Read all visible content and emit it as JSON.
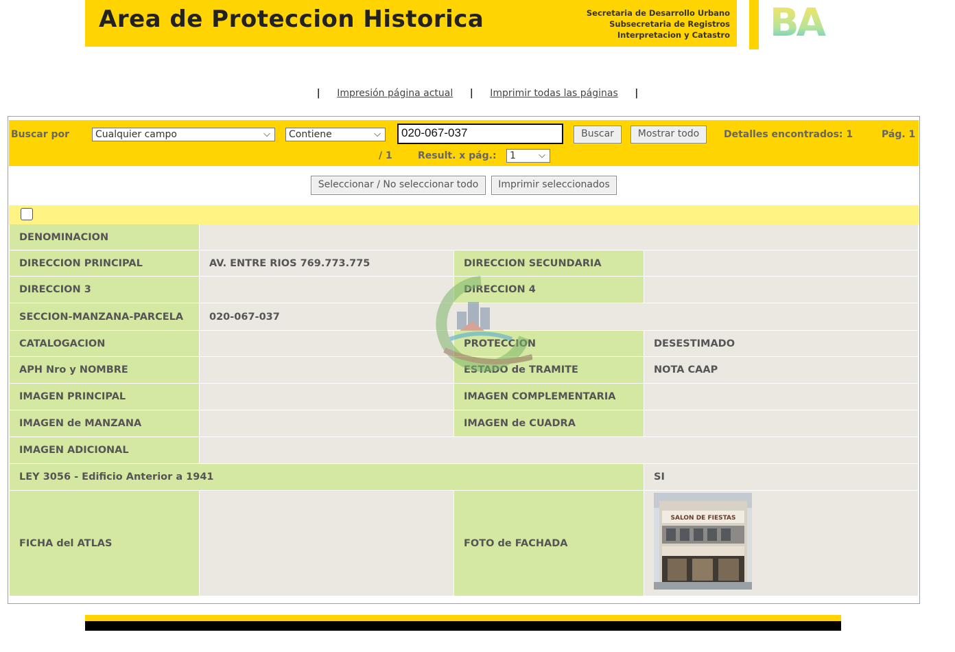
{
  "header": {
    "title": "Area de Proteccion Historica",
    "subtitle_lines": [
      "Secretaria de Desarrollo Urbano",
      "Subsecretaria de Registros",
      "Interpretacion y Catastro"
    ],
    "logo_text": "BA",
    "brand_color": "#ffd400"
  },
  "print_links": {
    "current_page": "Impresión página actual",
    "all_pages": "Imprimir todas las páginas",
    "separator": "|"
  },
  "search": {
    "label": "Buscar por",
    "field_select": "Cualquier campo",
    "operator_select": "Contiene",
    "query": "020-067-037",
    "search_button": "Buscar",
    "show_all_button": "Mostrar todo",
    "found": "Detalles encontrados: 1",
    "page_prefix": "Pág. 1",
    "page_total": "/ 1",
    "per_page_label": "Result. x pág.:",
    "per_page_value": "1"
  },
  "selection": {
    "select_all_button": "Seleccionar / No seleccionar todo",
    "print_selected_button": "Imprimir seleccionados"
  },
  "record": {
    "denominacion_label": "DENOMINACION",
    "denominacion_value": "",
    "dir_principal_label": "DIRECCION PRINCIPAL",
    "dir_principal_value": "AV. ENTRE RIOS 769.773.775",
    "dir_secundaria_label": "DIRECCION SECUNDARIA",
    "dir_secundaria_value": "",
    "dir3_label": "DIRECCION 3",
    "dir3_value": "",
    "dir4_label": "DIRECCION 4",
    "dir4_value": "",
    "smp_label": "SECCION-MANZANA-PARCELA",
    "smp_value": "020-067-037",
    "catalogacion_label": "CATALOGACION",
    "catalogacion_value": "",
    "proteccion_label": "PROTECCION",
    "proteccion_value": "DESESTIMADO",
    "aph_label": "APH Nro y NOMBRE",
    "aph_value": "",
    "estado_label": "ESTADO de TRAMITE",
    "estado_value": "NOTA CAAP",
    "img_principal_label": "IMAGEN PRINCIPAL",
    "img_complementaria_label": "IMAGEN COMPLEMENTARIA",
    "img_manzana_label": "IMAGEN de MANZANA",
    "img_cuadra_label": "IMAGEN de CUADRA",
    "img_adicional_label": "IMAGEN ADICIONAL",
    "ley_label": "LEY 3056 - Edificio Anterior a 1941",
    "ley_value": "SI",
    "ficha_label": "FICHA del ATLAS",
    "foto_label": "FOTO de FACHADA",
    "photo_sign_text": "SALON DE FIESTAS"
  }
}
